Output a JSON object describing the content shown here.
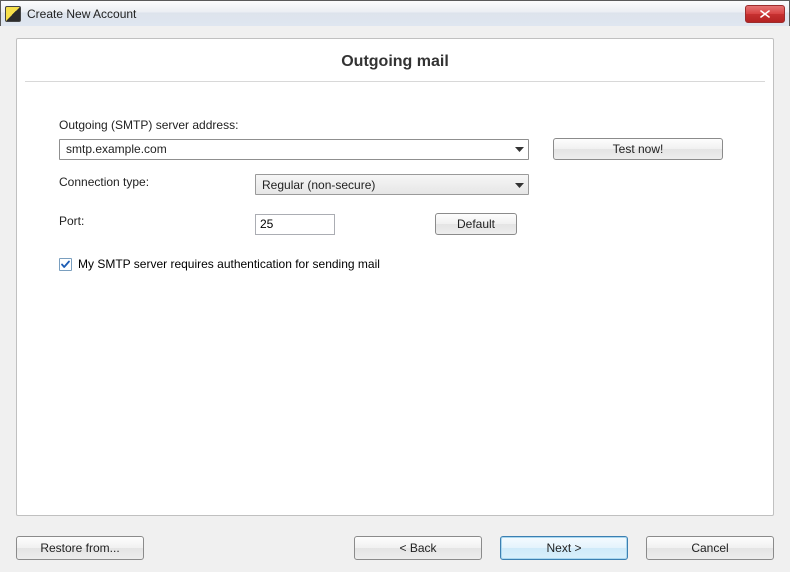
{
  "window": {
    "title": "Create New Account"
  },
  "panel": {
    "heading": "Outgoing mail"
  },
  "form": {
    "server_label": "Outgoing (SMTP) server address:",
    "server_value": "smtp.example.com",
    "test_label": "Test now!",
    "connection_label": "Connection type:",
    "connection_value": "Regular (non-secure)",
    "port_label": "Port:",
    "port_value": "25",
    "default_label": "Default",
    "auth_checked": true,
    "auth_label": "My SMTP server requires authentication for sending mail"
  },
  "footer": {
    "restore_label": "Restore from...",
    "back_label": "<  Back",
    "next_label": "Next  >",
    "cancel_label": "Cancel"
  }
}
